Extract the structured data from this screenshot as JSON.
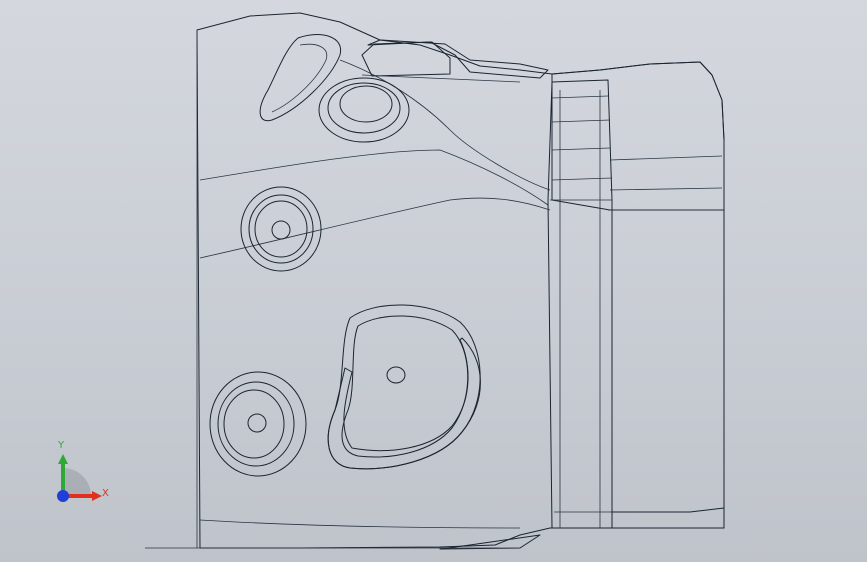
{
  "viewport": {
    "background_top": "#d4d8de",
    "background_bottom": "#bfc3ca"
  },
  "model": {
    "name_icon": "cad-part-3d-view",
    "body_color": "#7fb3e6",
    "highlight_color": "#e06056"
  },
  "triad": {
    "icon": "coordinate-triad-icon",
    "x_label": "X",
    "y_label": "Y",
    "x_color": "#e0301f",
    "y_color": "#2fa83a",
    "z_color": "#1f3fd6"
  }
}
